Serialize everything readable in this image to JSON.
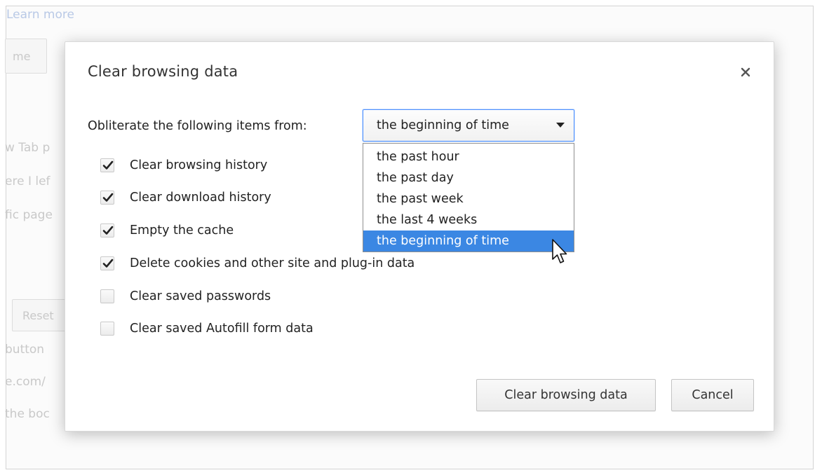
{
  "background": {
    "learn_more": "Learn more",
    "button_partial": "me",
    "lines": [
      "w Tab p",
      "ere I lef",
      "fic page"
    ],
    "reset_button": "Reset",
    "lower_lines": [
      "button",
      "e.com/",
      "the boc"
    ]
  },
  "dialog": {
    "title": "Clear browsing data",
    "close_glyph": "×",
    "prompt": "Obliterate the following items from:",
    "select": {
      "value": "the beginning of time",
      "options": [
        "the past hour",
        "the past day",
        "the past week",
        "the last 4 weeks",
        "the beginning of time"
      ],
      "highlighted_index": 4
    },
    "checkboxes": [
      {
        "label": "Clear browsing history",
        "checked": true
      },
      {
        "label": "Clear download history",
        "checked": true
      },
      {
        "label": "Empty the cache",
        "checked": true
      },
      {
        "label": "Delete cookies and other site and plug-in data",
        "checked": true
      },
      {
        "label": "Clear saved passwords",
        "checked": false
      },
      {
        "label": "Clear saved Autofill form data",
        "checked": false
      }
    ],
    "buttons": {
      "confirm": "Clear browsing data",
      "cancel": "Cancel"
    }
  },
  "icons": {
    "close": "close-icon",
    "dropdown_arrow": "chevron-down-icon",
    "checkmark": "check-icon",
    "cursor": "mouse-pointer-icon"
  },
  "colors": {
    "highlight": "#3b87e3",
    "focus_border": "#4d90fe"
  }
}
